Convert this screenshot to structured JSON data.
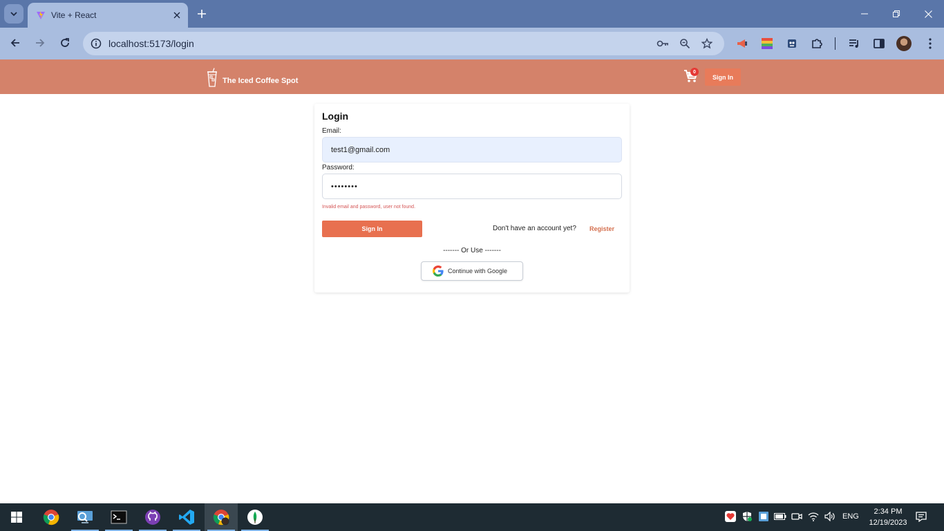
{
  "browser": {
    "tab_title": "Vite + React",
    "url": "localhost:5173/login",
    "icons": {
      "tab_search": "chevron-down-icon",
      "favicon": "vite-icon",
      "tab_close": "close-icon",
      "new_tab": "plus-icon",
      "minimize": "minimize-icon",
      "restore": "restore-icon",
      "close_window": "close-icon",
      "back": "back-arrow-icon",
      "forward": "forward-arrow-icon",
      "reload": "reload-icon",
      "site_info": "info-icon",
      "password_key": "key-icon",
      "zoom": "zoom-icon",
      "bookmark": "star-icon",
      "extensions": [
        "megaphone-extension-icon",
        "color-palette-extension-icon",
        "robot-extension-icon",
        "puzzle-extensions-icon"
      ],
      "media": "media-queue-icon",
      "side_panel": "side-panel-icon",
      "profile": "avatar",
      "menu": "kebab-menu-icon"
    }
  },
  "header": {
    "brand_name": "The Iced Coffee Spot",
    "cart_count": "0",
    "signin_label": "Sign In",
    "colors": {
      "background": "#d4826a",
      "button": "#e87b5a"
    }
  },
  "login": {
    "title": "Login",
    "email_label": "Email:",
    "email_value": "test1@gmail.com",
    "password_label": "Password:",
    "password_value": "••••••••",
    "error_message": "Invalid email and password, user not found.",
    "signin_label": "Sign In",
    "no_account_text": "Don't have an account yet?",
    "register_label": "Register",
    "divider_text": "------- Or Use -------",
    "google_label": "Continue with Google",
    "colors": {
      "accent": "#e8704f",
      "error": "#d45454",
      "email_fill": "#e8f0fe"
    }
  },
  "taskbar": {
    "apps": [
      "windows-start-icon",
      "chrome-icon",
      "remote-desktop-icon",
      "terminal-icon",
      "github-desktop-icon",
      "vscode-icon",
      "chrome-profile-icon",
      "mongodb-compass-icon"
    ],
    "tray": [
      "heart-icon",
      "security-icon",
      "app-tray-icon",
      "battery-icon",
      "camera-icon",
      "wifi-icon",
      "volume-icon",
      "notification-icon"
    ],
    "language": "ENG",
    "time": "2:34 PM",
    "date": "12/19/2023"
  }
}
